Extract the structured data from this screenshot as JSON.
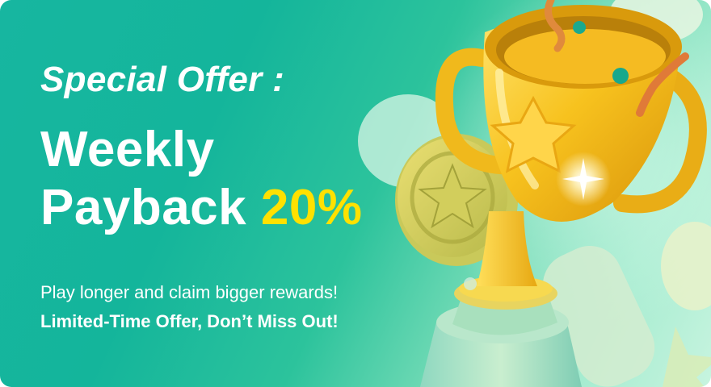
{
  "banner": {
    "eyebrow": "Special Offer :",
    "title_line1": "Weekly",
    "title_line2": "Payback",
    "highlight": "20%",
    "subtitle": "Play longer and claim bigger rewards!",
    "cta_note": "Limited-Time Offer, Don’t Miss Out!"
  },
  "colors": {
    "background_start": "#14b59b",
    "background_end": "#c7f4df",
    "text": "#ffffff",
    "accent": "#ffe100",
    "trophy_gold": "#f7c21e"
  },
  "icons": [
    "trophy-icon",
    "coin-icon",
    "star-icon",
    "confetti-icon"
  ]
}
